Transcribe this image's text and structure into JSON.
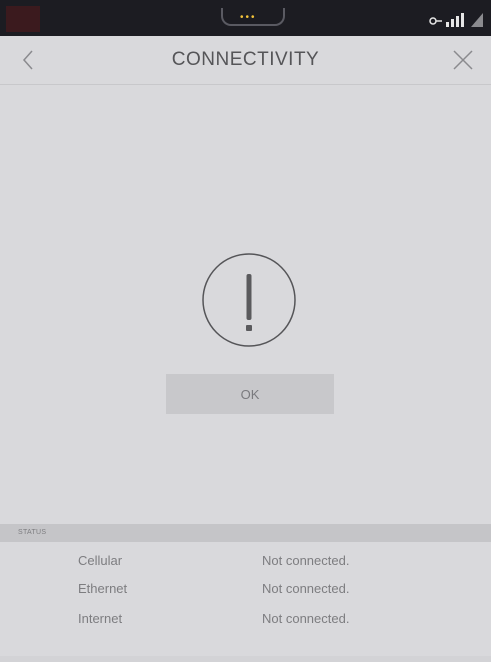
{
  "header": {
    "title": "CONNECTIVITY"
  },
  "dialog": {
    "ok_label": "OK"
  },
  "status": {
    "section_label": "STATUS",
    "rows": [
      {
        "label": "Cellular",
        "value": "Not connected."
      },
      {
        "label": "Ethernet",
        "value": "Not connected."
      },
      {
        "label": "Internet",
        "value": "Not connected."
      }
    ]
  },
  "colors": {
    "background": "#d9d9dc",
    "statusbar": "#1c1c22",
    "notification_dots": "#f2c23a"
  },
  "icons": [
    "back-chevron-icon",
    "close-icon",
    "alert-exclamation-icon",
    "wifi-key-icon",
    "signal-icon",
    "triangle-icon"
  ]
}
